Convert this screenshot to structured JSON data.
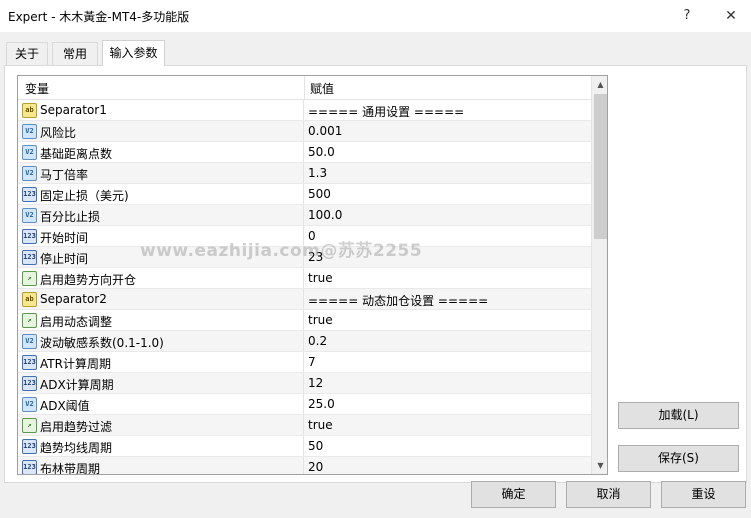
{
  "window": {
    "title": "Expert - 木木黃金-MT4-多功能版",
    "help_glyph": "?",
    "close_glyph": "✕"
  },
  "tabs": [
    {
      "label": "关于"
    },
    {
      "label": "常用"
    },
    {
      "label": "输入参数",
      "active": true
    }
  ],
  "grid": {
    "columns": [
      "变量",
      "赋值"
    ],
    "rows": [
      {
        "icon": "ab",
        "name": "Separator1",
        "value": "===== 通用设置 ====="
      },
      {
        "icon": "Va",
        "name": "风险比",
        "value": "0.001"
      },
      {
        "icon": "Va",
        "name": "基础距离点数",
        "value": "50.0"
      },
      {
        "icon": "Va",
        "name": "马丁倍率",
        "value": "1.3"
      },
      {
        "icon": "123",
        "name": "固定止损（美元)",
        "value": "500"
      },
      {
        "icon": "Va",
        "name": "百分比止损",
        "value": "100.0"
      },
      {
        "icon": "123",
        "name": "开始时间",
        "value": "0"
      },
      {
        "icon": "123",
        "name": "停止时间",
        "value": "23"
      },
      {
        "icon": "bool",
        "name": "启用趋势方向开仓",
        "value": "true"
      },
      {
        "icon": "ab",
        "name": "Separator2",
        "value": "===== 动态加仓设置 ====="
      },
      {
        "icon": "bool",
        "name": "启用动态调整",
        "value": "true"
      },
      {
        "icon": "Va",
        "name": "波动敏感系数(0.1-1.0)",
        "value": "0.2"
      },
      {
        "icon": "123",
        "name": "ATR计算周期",
        "value": "7"
      },
      {
        "icon": "123",
        "name": "ADX计算周期",
        "value": "12"
      },
      {
        "icon": "Va",
        "name": "ADX阈值",
        "value": "25.0"
      },
      {
        "icon": "bool",
        "name": "启用趋势过滤",
        "value": "true"
      },
      {
        "icon": "123",
        "name": "趋势均线周期",
        "value": "50"
      },
      {
        "icon": "123",
        "name": "布林带周期",
        "value": "20"
      }
    ]
  },
  "watermark": "www.eazhijia.com@苏苏2255",
  "buttons": {
    "load": "加载(L)",
    "save": "保存(S)",
    "ok": "确定",
    "cancel": "取消",
    "reset": "重设"
  },
  "icons": {
    "ab": "string-param-icon",
    "Va": "double-param-icon",
    "123": "integer-param-icon",
    "bool": "bool-param-icon"
  }
}
